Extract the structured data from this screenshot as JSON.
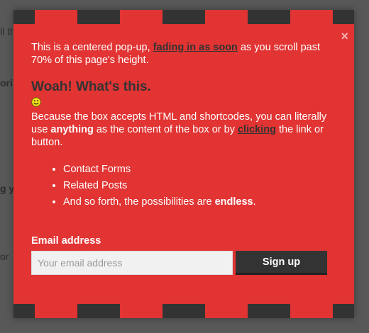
{
  "background": {
    "fragments": [
      "ll th",
      "ori",
      "g y",
      "or"
    ]
  },
  "popup": {
    "close_label": "×",
    "intro_pre": "This is a centered pop-up, ",
    "intro_link": "fading in as soon",
    "intro_post": " as you scroll past 70% of this page's height.",
    "heading": "Woah! What's this.",
    "smiley_icon": "smiley-icon",
    "body_pre": "Because the box accepts HTML and shortcodes, you can literally use ",
    "body_bold": "anything",
    "body_mid": " as the content of the box or by ",
    "body_link": "clicking",
    "body_post": " the link or button.",
    "list": {
      "item1": "Contact Forms",
      "item2": "Related Posts",
      "item3_pre": "And so forth, the possibilities are ",
      "item3_bold": "endless",
      "item3_post": "."
    },
    "form": {
      "label": "Email address",
      "placeholder": "Your email address",
      "button_label": "Sign up"
    }
  },
  "colors": {
    "popup_bg": "#e13433",
    "stripe_dark": "#333333",
    "page_bg": "#585858",
    "button_bg": "#333333"
  }
}
